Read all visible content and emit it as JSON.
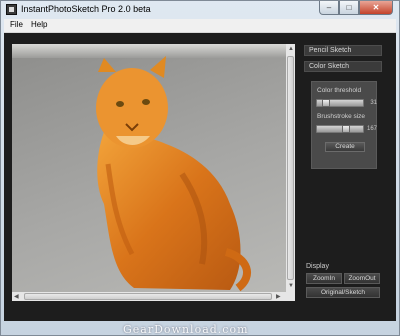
{
  "window": {
    "title": "InstantPhotoSketch Pro 2.0 beta",
    "controls": {
      "minimize": "–",
      "maximize": "□",
      "close": "✕"
    }
  },
  "menu": {
    "items": [
      "File",
      "Help"
    ]
  },
  "image": {
    "subject": "orange tabby cat sitting on pavement, color sketch effect"
  },
  "panel": {
    "tabs": [
      "Pencil Sketch",
      "Color Sketch"
    ],
    "color_threshold": {
      "label": "Color threshold",
      "value": "31",
      "level": 0.12
    },
    "brushstroke_size": {
      "label": "Brushstroke size",
      "value": "167",
      "level": 0.65
    },
    "create_label": "Create"
  },
  "display": {
    "label": "Display",
    "zoom_in": "ZoomIn",
    "zoom_out": "ZoomOut",
    "original_sketch": "Original/Sketch"
  },
  "watermark": "GearDownload.com",
  "colors": {
    "background": "#1d1d1d",
    "panel": "#4a4a4a",
    "cat": "#e0821c"
  },
  "icons": [
    "app-icon",
    "minimize-icon",
    "maximize-icon",
    "close-icon"
  ]
}
